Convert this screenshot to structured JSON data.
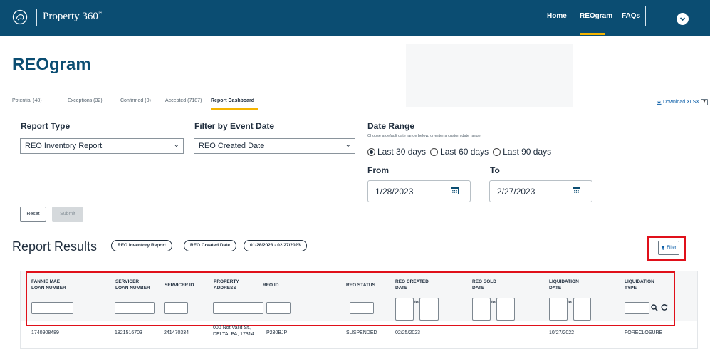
{
  "header": {
    "app_name": "Property 360",
    "trademark": "℠",
    "nav": [
      "Home",
      "REOgram",
      "FAQs"
    ],
    "active_nav": "REOgram",
    "user_menu_icon": "chevron-down-icon",
    "logo_icon": "property360-logo-icon"
  },
  "page_title": "REOgram",
  "tabs": [
    {
      "label": "Potential (48)"
    },
    {
      "label": "Exceptions (32)"
    },
    {
      "label": "Confirmed (0)"
    },
    {
      "label": "Accepted (7187)"
    },
    {
      "label": "Report Dashboard"
    }
  ],
  "active_tab": "Report Dashboard",
  "download_label": "Download XLSX",
  "report_type": {
    "label": "Report Type",
    "selected": "REO Inventory Report"
  },
  "filter_event": {
    "label": "Filter by Event Date",
    "selected": "REO Created Date"
  },
  "date_range": {
    "label": "Date Range",
    "hint": "Choose a default date range below, or enter a custom date range",
    "options": [
      "Last 30 days",
      "Last 60 days",
      "Last 90 days"
    ],
    "selected": "Last 30 days",
    "from_label": "From",
    "from_value": "1/28/2023",
    "to_label": "To",
    "to_value": "2/27/2023"
  },
  "buttons": {
    "reset": "Reset",
    "submit": "Submit"
  },
  "results": {
    "title": "Report Results",
    "chips": [
      "REO Inventory Report",
      "REO Created Date",
      "01/28/2023 - 02/27/2023"
    ],
    "filter_label": "Filter"
  },
  "table": {
    "columns": [
      [
        "FANNIE MAE",
        "LOAN NUMBER"
      ],
      [
        "SERVICER",
        "LOAN NUMBER"
      ],
      [
        "SERVICER ID"
      ],
      [
        "PROPERTY",
        "ADDRESS"
      ],
      [
        "REO ID"
      ],
      [
        "REO STATUS"
      ],
      [
        "REO CREATED",
        "DATE"
      ],
      [
        "REO SOLD",
        "DATE"
      ],
      [
        "LIQUIDATION",
        "DATE"
      ],
      [
        "LIQUIDATION",
        "TYPE"
      ]
    ],
    "range_separator": "to",
    "rows": [
      {
        "fannie_mae_loan": "1740908489",
        "servicer_loan": "1821516703",
        "servicer_id": "241470334",
        "address_line1": "000 Not Valid St.,",
        "address_line2": "DELTA, PA, 17314",
        "reo_id": "P230BJP",
        "reo_status": "SUSPENDED",
        "reo_created": "02/25/2023",
        "reo_sold": "",
        "liquidation_date": "10/27/2022",
        "liquidation_type": "FORECLOSURE"
      }
    ]
  },
  "colors": {
    "header_bg": "#0b4d72",
    "accent": "#f5b400",
    "highlight": "#e0101a",
    "link": "#0b5ea8"
  }
}
